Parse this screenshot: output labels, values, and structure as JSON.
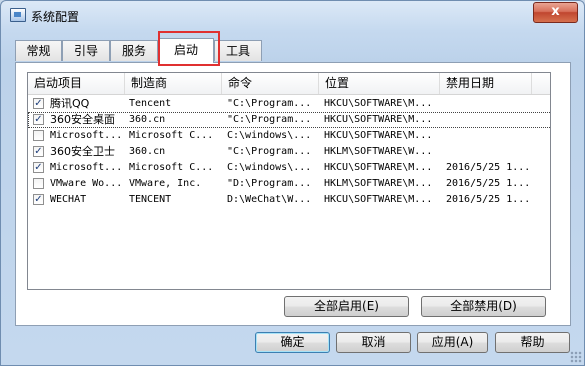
{
  "window": {
    "title": "系统配置",
    "close_label": "x"
  },
  "tabs": [
    "常规",
    "引导",
    "服务",
    "启动",
    "工具"
  ],
  "active_tab": "启动",
  "table": {
    "columns": [
      "启动项目",
      "制造商",
      "命令",
      "位置",
      "禁用日期"
    ],
    "rows": [
      {
        "checked": true,
        "item": "腾讯QQ",
        "maker": "Tencent",
        "command": "\"C:\\Program...",
        "location": "HKCU\\SOFTWARE\\M...",
        "date": ""
      },
      {
        "checked": true,
        "item": "360安全桌面",
        "maker": "360.cn",
        "command": "\"C:\\Program...",
        "location": "HKCU\\SOFTWARE\\M...",
        "date": ""
      },
      {
        "checked": false,
        "item": "Microsoft...",
        "maker": "Microsoft C...",
        "command": "C:\\windows\\...",
        "location": "HKCU\\SOFTWARE\\M...",
        "date": ""
      },
      {
        "checked": true,
        "item": "360安全卫士",
        "maker": "360.cn",
        "command": "\"C:\\Program...",
        "location": "HKLM\\SOFTWARE\\W...",
        "date": ""
      },
      {
        "checked": true,
        "item": "Microsoft...",
        "maker": "Microsoft C...",
        "command": "C:\\windows\\...",
        "location": "HKCU\\SOFTWARE\\M...",
        "date": "2016/5/25 1..."
      },
      {
        "checked": false,
        "item": "VMware Wo...",
        "maker": "VMware, Inc.",
        "command": "\"D:\\Program...",
        "location": "HKLM\\SOFTWARE\\M...",
        "date": "2016/5/25 1..."
      },
      {
        "checked": true,
        "item": "WECHAT",
        "maker": "TENCENT",
        "command": "D:\\WeChat\\W...",
        "location": "HKCU\\SOFTWARE\\M...",
        "date": "2016/5/25 1..."
      }
    ]
  },
  "panel_buttons": {
    "enable_all": "全部启用(E)",
    "disable_all": "全部禁用(D)"
  },
  "dialog_buttons": {
    "ok": "确定",
    "cancel": "取消",
    "apply": "应用(A)",
    "help": "帮助"
  }
}
